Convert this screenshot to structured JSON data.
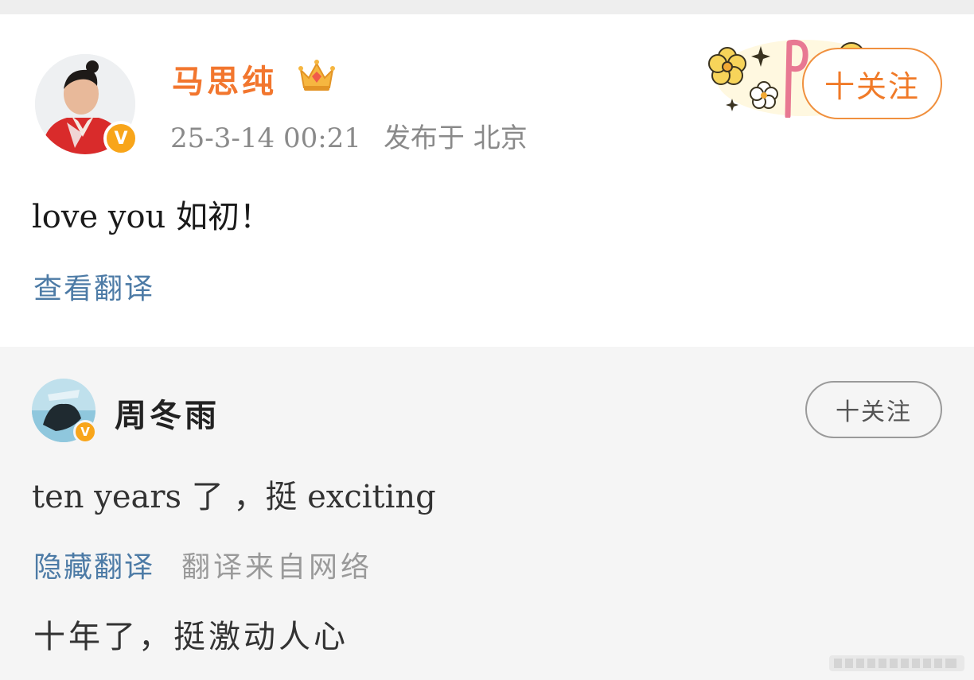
{
  "post": {
    "author": "马思纯",
    "time": "25-3-14 00:21",
    "location": "发布于 北京",
    "follow_label": "十关注",
    "text": "love you 如初！",
    "translate_link": "查看翻译"
  },
  "card": {
    "author": "周冬雨",
    "follow_label": "十关注",
    "text": "ten years 了 ，挺 exciting",
    "hide_translation": "隐藏翻译",
    "translation_source": "翻译来自网络",
    "translated_text": "十年了，挺激动人心"
  },
  "colors": {
    "accent_orange": "#f2762e",
    "link_blue": "#4d7ba6",
    "vip_badge": "#f8a51a",
    "card_bg": "#f5f5f5"
  }
}
